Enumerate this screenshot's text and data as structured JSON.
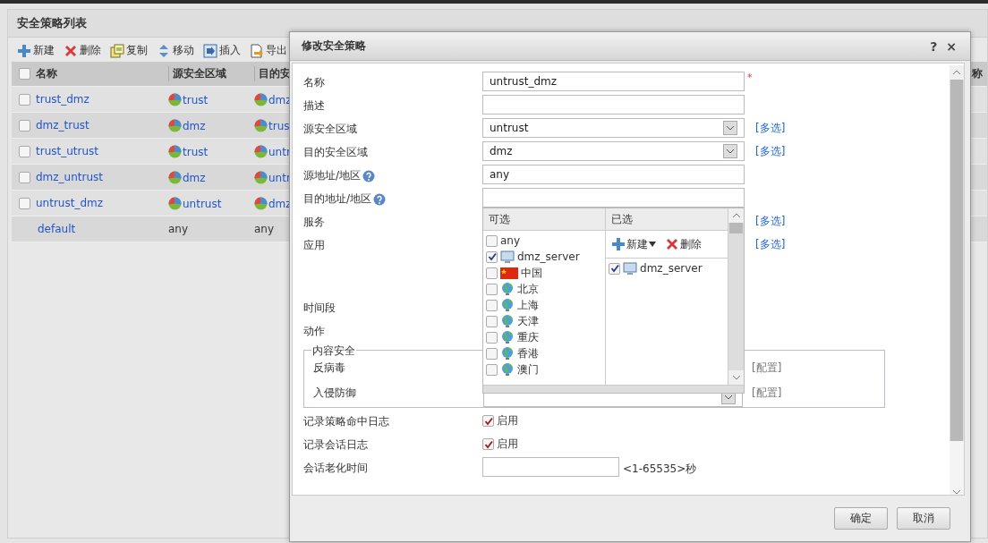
{
  "page": {
    "title": "安全策略列表",
    "toolbar": [
      {
        "label": "新建",
        "kind": "plus"
      },
      {
        "label": "删除",
        "kind": "delete"
      },
      {
        "label": "复制",
        "kind": "copy"
      },
      {
        "label": "移动",
        "kind": "move"
      },
      {
        "label": "插入",
        "kind": "insert"
      },
      {
        "label": "导出",
        "kind": "export"
      }
    ],
    "table": {
      "select_all_checked": false,
      "columns": [
        "名称",
        "源安全区域",
        "目的安"
      ],
      "edge_column": "称",
      "rows": [
        {
          "kind": "policy",
          "checked": false,
          "cells": [
            {
              "kind": "link",
              "text": "trust_dmz"
            },
            {
              "kind": "zone",
              "text": "trust"
            },
            {
              "kind": "zone",
              "text": "dmz"
            }
          ]
        },
        {
          "kind": "policy",
          "checked": false,
          "cells": [
            {
              "kind": "link",
              "text": "dmz_trust"
            },
            {
              "kind": "zone",
              "text": "dmz"
            },
            {
              "kind": "zone",
              "text": "trus"
            }
          ]
        },
        {
          "kind": "policy",
          "checked": false,
          "cells": [
            {
              "kind": "link",
              "text": "trust_utrust"
            },
            {
              "kind": "zone",
              "text": "trust"
            },
            {
              "kind": "zone",
              "text": "untr"
            }
          ]
        },
        {
          "kind": "policy",
          "checked": false,
          "cells": [
            {
              "kind": "link",
              "text": "dmz_untrust"
            },
            {
              "kind": "zone",
              "text": "dmz"
            },
            {
              "kind": "zone",
              "text": "untr"
            }
          ]
        },
        {
          "kind": "policy",
          "checked": false,
          "cells": [
            {
              "kind": "link",
              "text": "untrust_dmz"
            },
            {
              "kind": "zone",
              "text": "untrust"
            },
            {
              "kind": "zone",
              "text": "dmz"
            }
          ]
        },
        {
          "kind": "default",
          "cells": [
            {
              "kind": "link",
              "text": "default"
            },
            {
              "kind": "plain",
              "text": "any"
            },
            {
              "kind": "plain",
              "text": "any"
            }
          ]
        }
      ]
    }
  },
  "dialog": {
    "title": "修改安全策略",
    "help": "?",
    "close": "×",
    "fields": [
      {
        "kind": "input",
        "label": "名称",
        "value": "untrust_dmz",
        "required_mark": "*"
      },
      {
        "kind": "input",
        "label": "描述"
      },
      {
        "kind": "select",
        "label": "源安全区域",
        "value": "untrust",
        "link": "[多选]"
      },
      {
        "kind": "select",
        "label": "目的安全区域",
        "value": "dmz",
        "link": "[多选]"
      },
      {
        "kind": "input",
        "label": "源地址/地区",
        "help": true,
        "value": "any"
      },
      {
        "kind": "picker",
        "label": "目的地址/地区",
        "help": true
      },
      {
        "kind": "empty",
        "label": "服务",
        "link": "[多选]"
      },
      {
        "kind": "tall",
        "label": "应用",
        "link": "[多选]"
      },
      {
        "kind": "empty",
        "label": "时间段"
      },
      {
        "kind": "empty",
        "label": "动作"
      }
    ],
    "popup": {
      "available_header": "可选",
      "selected_header": "已选",
      "available": [
        {
          "label": "any",
          "kind": "none",
          "checked": false
        },
        {
          "label": "dmz_server",
          "kind": "host",
          "checked": true
        },
        {
          "label": "中国",
          "kind": "flag",
          "checked": false
        },
        {
          "label": "北京",
          "kind": "globe",
          "checked": false
        },
        {
          "label": "上海",
          "kind": "globe",
          "checked": false
        },
        {
          "label": "天津",
          "kind": "globe",
          "checked": false
        },
        {
          "label": "重庆",
          "kind": "globe",
          "checked": false
        },
        {
          "label": "香港",
          "kind": "globe",
          "checked": false
        },
        {
          "label": "澳门",
          "kind": "globe",
          "checked": false
        }
      ],
      "toolbar": [
        {
          "label": "新建",
          "kind": "plus",
          "menu": true
        },
        {
          "label": "删除",
          "kind": "delete",
          "menu": false
        }
      ],
      "selected": [
        {
          "label": "dmz_server",
          "kind": "host",
          "checked": true
        }
      ]
    },
    "content_security": {
      "legend": "内容安全",
      "rows": [
        {
          "kind": "plain",
          "label": "反病毒",
          "link": "[配置]"
        },
        {
          "kind": "select",
          "label": "入侵防御",
          "link": "[配置]"
        }
      ]
    },
    "log_fields": [
      {
        "label": "记录策略命中日志",
        "option": "启用",
        "checked": true
      },
      {
        "label": "记录会话日志",
        "option": "启用",
        "checked": true
      }
    ],
    "timeout": {
      "label": "会话老化时间",
      "hint": "<1-65535>秒"
    },
    "buttons": [
      "确定",
      "取消"
    ]
  }
}
